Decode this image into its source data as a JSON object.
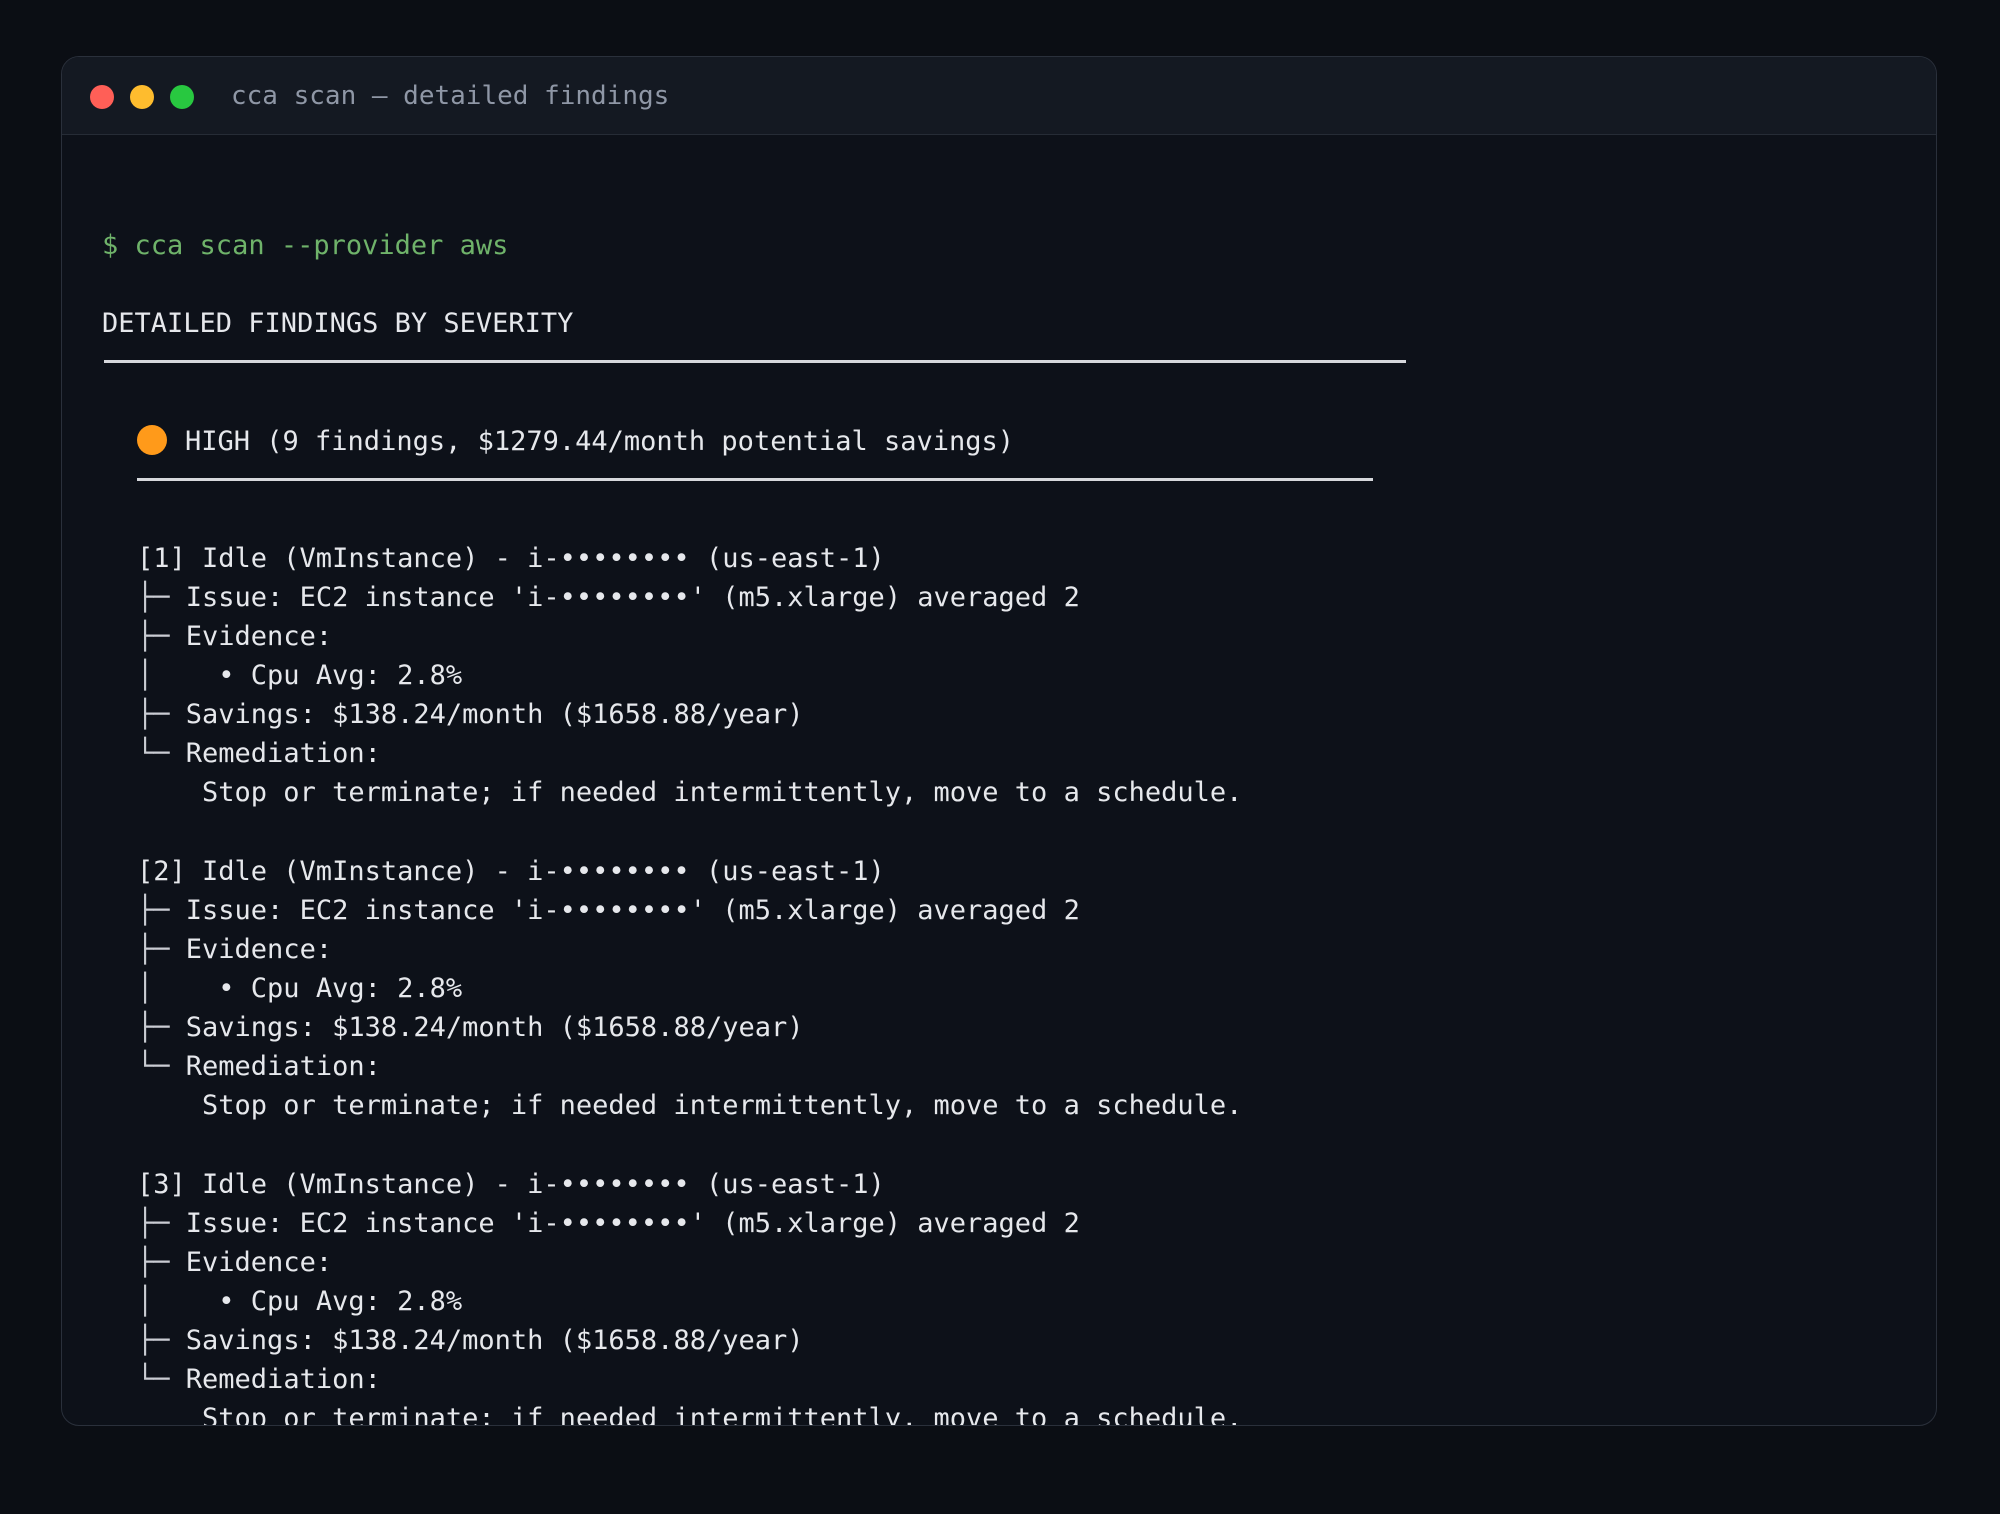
{
  "window": {
    "title": "cca scan — detailed findings"
  },
  "terminal": {
    "prompt_symbol": "$",
    "command": "cca scan --provider aws",
    "section_heading": "DETAILED FINDINGS BY SEVERITY",
    "severity_group": {
      "icon": "orange-circle-icon",
      "label": "HIGH (9 findings, $1279.44/month potential savings)"
    },
    "findings": [
      {
        "header": "[1] Idle (VmInstance) - i-•••••••• (us-east-1)",
        "issue": "Issue: EC2 instance 'i-••••••••' (m5.xlarge) averaged 2",
        "evidence": "Evidence:",
        "evidence_item": "• Cpu Avg: 2.8%",
        "savings": "Savings: $138.24/month ($1658.88/year)",
        "remediation": "Remediation:",
        "remediation_text": "Stop or terminate; if needed intermittently, move to a schedule."
      },
      {
        "header": "[2] Idle (VmInstance) - i-•••••••• (us-east-1)",
        "issue": "Issue: EC2 instance 'i-••••••••' (m5.xlarge) averaged 2",
        "evidence": "Evidence:",
        "evidence_item": "• Cpu Avg: 2.8%",
        "savings": "Savings: $138.24/month ($1658.88/year)",
        "remediation": "Remediation:",
        "remediation_text": "Stop or terminate; if needed intermittently, move to a schedule."
      },
      {
        "header": "[3] Idle (VmInstance) - i-•••••••• (us-east-1)",
        "issue": "Issue: EC2 instance 'i-••••••••' (m5.xlarge) averaged 2",
        "evidence": "Evidence:",
        "evidence_item": "• Cpu Avg: 2.8%",
        "savings": "Savings: $138.24/month ($1658.88/year)",
        "remediation": "Remediation:",
        "remediation_text": "Stop or terminate; if needed intermittently, move to a schedule."
      }
    ]
  },
  "colors": {
    "high_severity": "#ff9a1a",
    "prompt": "#6fb36a"
  }
}
